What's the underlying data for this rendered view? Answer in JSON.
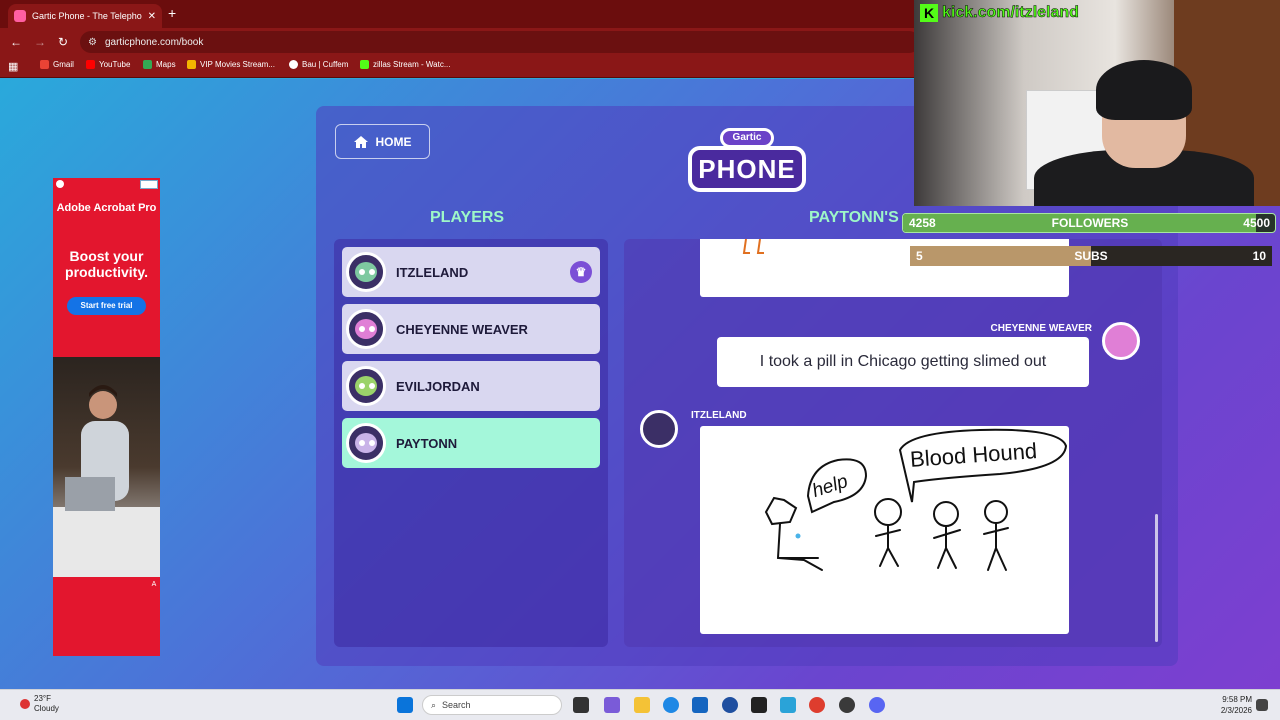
{
  "browser": {
    "tab_title": "Gartic Phone - The Telephone Game",
    "url": "garticphone.com/book",
    "bookmarks": [
      "Gmail",
      "YouTube",
      "Maps",
      "VIP Movies Stream...",
      "Bau | Cuffem",
      "zillas Stream - Watc..."
    ]
  },
  "ad": {
    "brand": "Adobe Acrobat Pro",
    "headline": "Boost your productivity.",
    "cta": "Start free trial"
  },
  "game": {
    "home_label": "HOME",
    "logo_top": "Gartic",
    "logo_main": "PHONE",
    "players_title": "PLAYERS",
    "album_title": "PAYTONN'S",
    "players": [
      {
        "name": "ITZLELAND",
        "host": true,
        "active": false,
        "color": "#7ec9a0"
      },
      {
        "name": "CHEYENNE WEAVER",
        "host": false,
        "active": false,
        "color": "#e07fd6"
      },
      {
        "name": "EVILJORDAN",
        "host": false,
        "active": false,
        "color": "#9bd36a"
      },
      {
        "name": "PAYTONN",
        "host": false,
        "active": true,
        "color": "#c9b3e8"
      }
    ],
    "album": {
      "guess_author": "CHEYENNE WEAVER",
      "guess_text": "I took a pill in Chicago getting slimed out",
      "drawing_author": "ITZLELAND",
      "drawing_words": [
        "help",
        "Blood Hound"
      ]
    }
  },
  "stream": {
    "kick_url": "kick.com/itzleland",
    "followers_label": "FOLLOWERS",
    "followers_current": "4258",
    "followers_goal": "4500",
    "followers_progress": 0.95,
    "subs_label": "SUBS",
    "subs_current": "5",
    "subs_goal": "10",
    "subs_progress": 0.5
  },
  "taskbar": {
    "temp": "23°F",
    "condition": "Cloudy",
    "search_placeholder": "Search",
    "time": "9:58 PM",
    "date": "2/3/2026"
  }
}
